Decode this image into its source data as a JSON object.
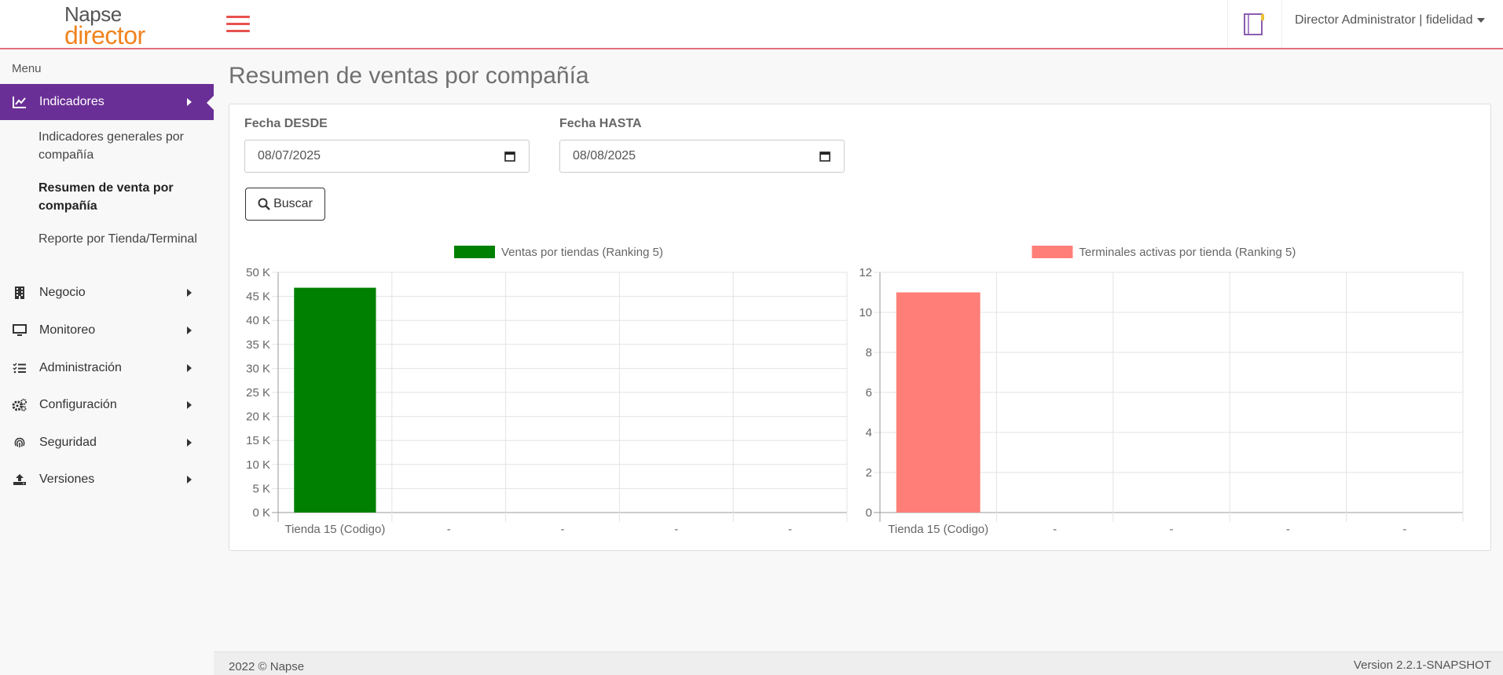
{
  "header": {
    "logo_top": "Napse",
    "logo_bottom": "director",
    "user_label": "Director Administrator | fidelidad"
  },
  "sidebar": {
    "caption": "Menu",
    "items": [
      {
        "label": "Indicadores",
        "icon": "chart-line-icon",
        "active": true
      },
      {
        "label": "Negocio",
        "icon": "building-icon"
      },
      {
        "label": "Monitoreo",
        "icon": "monitor-icon"
      },
      {
        "label": "Administración",
        "icon": "tasks-list-icon"
      },
      {
        "label": "Configuración",
        "icon": "gears-icon"
      },
      {
        "label": "Seguridad",
        "icon": "fingerprint-icon"
      },
      {
        "label": "Versiones",
        "icon": "upload-icon"
      }
    ],
    "subitems": [
      {
        "label": "Indicadores generales por compañía"
      },
      {
        "label": "Resumen de venta por compañía",
        "current": true
      },
      {
        "label": "Reporte por Tienda/Terminal"
      }
    ]
  },
  "main": {
    "title": "Resumen de ventas por compañía",
    "filters": {
      "from_label": "Fecha DESDE",
      "from_value": "08/07/2025",
      "to_label": "Fecha HASTA",
      "to_value": "08/08/2025",
      "search_label": "Buscar"
    }
  },
  "chart_data": [
    {
      "type": "bar",
      "legend": "Ventas por tiendas (Ranking 5)",
      "color": "#008000",
      "categories": [
        "Tienda 15 (Codigo)",
        "-",
        "-",
        "-",
        "-"
      ],
      "values": [
        46800,
        0,
        0,
        0,
        0
      ],
      "ylim": [
        0,
        50000
      ],
      "yticks": [
        "0 K",
        "5 K",
        "10 K",
        "15 K",
        "20 K",
        "25 K",
        "30 K",
        "35 K",
        "40 K",
        "45 K",
        "50 K"
      ],
      "grid": true,
      "legend_position": "top"
    },
    {
      "type": "bar",
      "legend": "Terminales activas por tienda (Ranking 5)",
      "color": "#ff7f78",
      "categories": [
        "Tienda 15 (Codigo)",
        "-",
        "-",
        "-",
        "-"
      ],
      "values": [
        11,
        0,
        0,
        0,
        0
      ],
      "ylim": [
        0,
        12
      ],
      "yticks": [
        "0",
        "2",
        "4",
        "6",
        "8",
        "10",
        "12"
      ],
      "grid": true,
      "legend_position": "top"
    }
  ],
  "footer": {
    "copyright": "2022 © Napse",
    "version": "Version 2.2.1-SNAPSHOT"
  }
}
